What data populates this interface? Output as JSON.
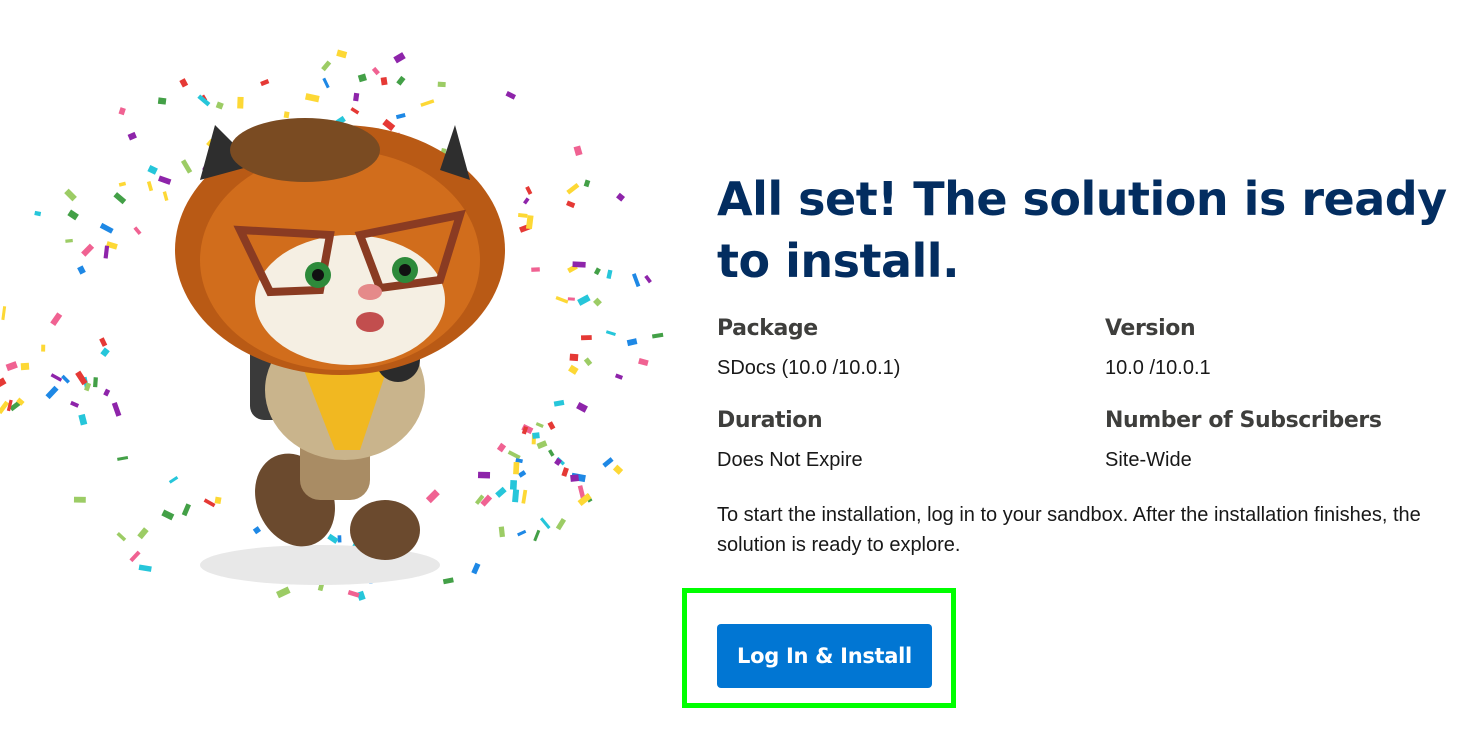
{
  "page": {
    "title": "All set! The solution is ready to install.",
    "illustration": "celebrating-mascot-with-confetti"
  },
  "details": {
    "package": {
      "label": "Package",
      "value": "SDocs (10.0 /10.0.1)"
    },
    "version": {
      "label": "Version",
      "value": "10.0 /10.0.1"
    },
    "duration": {
      "label": "Duration",
      "value": "Does Not Expire"
    },
    "subscribers": {
      "label": "Number of Subscribers",
      "value": "Site-Wide"
    }
  },
  "instructions": "To start the installation, log in to your sandbox. After the installation finishes, the solution is ready to explore.",
  "actions": {
    "install_label": "Log In & Install"
  },
  "colors": {
    "title": "#032d60",
    "button": "#0176d3",
    "highlight": "#00ff00"
  }
}
